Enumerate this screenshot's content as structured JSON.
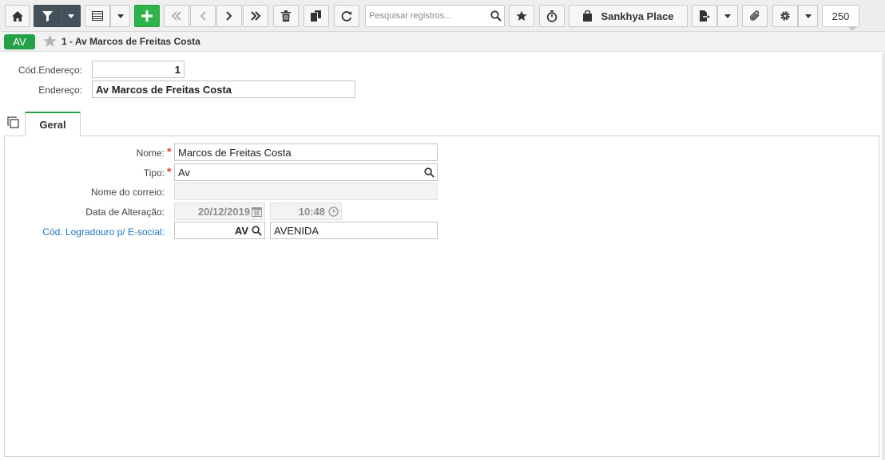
{
  "toolbar": {
    "search_placeholder": "Pesquisar registros...",
    "place_label": "Sankhya Place",
    "record_count": "250"
  },
  "record": {
    "tag": "AV",
    "title": "1 - Av Marcos de Freitas Costa"
  },
  "header_fields": {
    "cod_label": "Cód.Endereço:",
    "cod_value": "1",
    "endereco_label": "Endereço:",
    "endereco_value": "Av Marcos de Freitas Costa"
  },
  "tabs": [
    {
      "label": "Geral",
      "active": true
    }
  ],
  "form": {
    "nome_label": "Nome:",
    "nome_value": "Marcos de Freitas Costa",
    "tipo_label": "Tipo:",
    "tipo_value": "Av",
    "correio_label": "Nome do correio:",
    "correio_value": "",
    "data_label": "Data de Alteração:",
    "data_value": "20/12/2019",
    "hora_value": "10:48",
    "logradouro_label": "Cód. Logradouro p/ E-social:",
    "logradouro_code": "AV",
    "logradouro_desc": "AVENIDA"
  },
  "colors": {
    "accent_green": "#24a148",
    "dark_button": "#44515a",
    "link_blue": "#1e73be",
    "required_red": "#e0413a"
  }
}
